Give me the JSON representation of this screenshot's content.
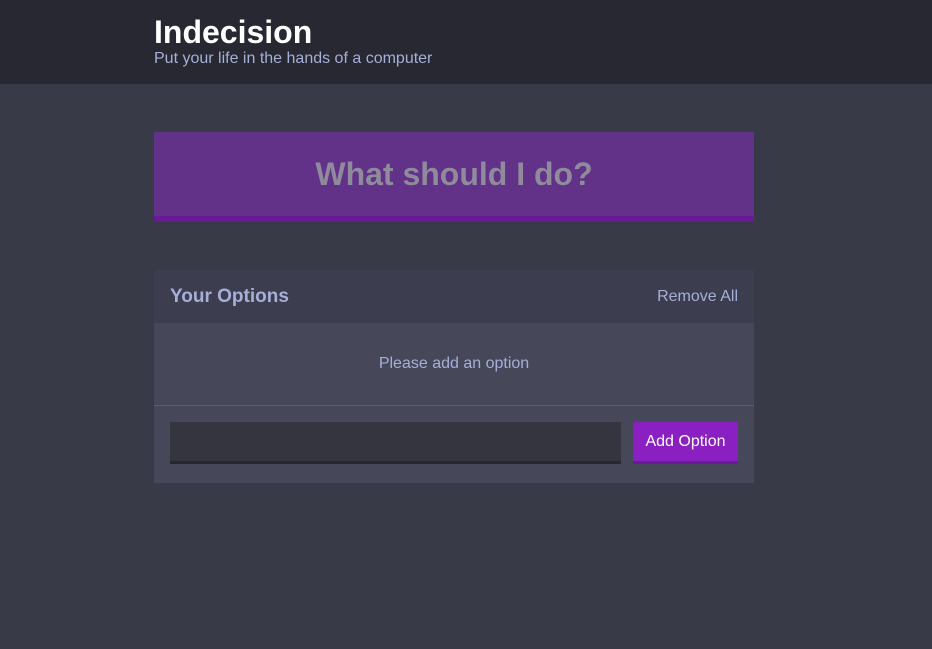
{
  "header": {
    "title": "Indecision",
    "subtitle": "Put your life in the hands of a computer"
  },
  "action": {
    "label": "What should I do?"
  },
  "options": {
    "title": "Your Options",
    "remove_all_label": "Remove All",
    "empty_message": "Please add an option",
    "input_value": "",
    "add_button_label": "Add Option"
  },
  "colors": {
    "background": "#383a48",
    "header_background": "#272831",
    "action_button": "#623188",
    "accent": "#8b20c2",
    "text_muted": "#a5afd7"
  }
}
